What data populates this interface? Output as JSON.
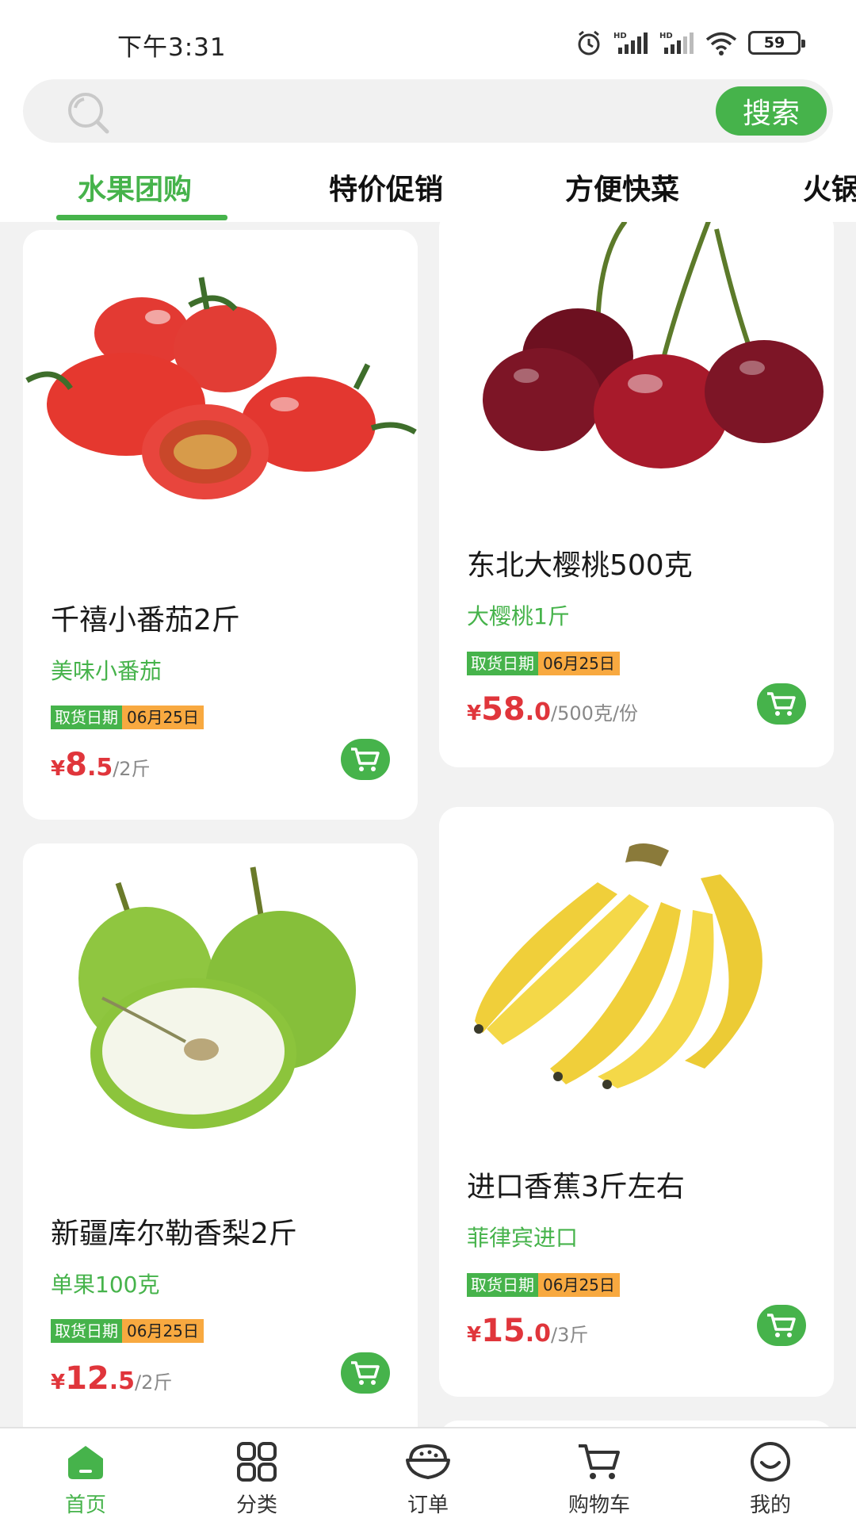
{
  "status_bar": {
    "time": "下午3:31",
    "battery": "59"
  },
  "search": {
    "placeholder": "",
    "button_label": "搜索"
  },
  "tabs": [
    {
      "label": "水果团购",
      "active": true
    },
    {
      "label": "特价促销",
      "active": false
    },
    {
      "label": "方便快菜",
      "active": false
    },
    {
      "label": "火锅",
      "active": false
    }
  ],
  "products": [
    {
      "name": "千禧小番茄2斤",
      "subtitle": "美味小番茄",
      "pickup_label": "取货日期",
      "pickup_date": "06月25日",
      "currency": "¥",
      "price_int": "8",
      "price_dec": ".5",
      "unit": "/2斤",
      "image": "cherry-tomatoes"
    },
    {
      "name": "东北大樱桃500克",
      "subtitle": "大樱桃1斤",
      "pickup_label": "取货日期",
      "pickup_date": "06月25日",
      "currency": "¥",
      "price_int": "58",
      "price_dec": ".0",
      "unit": "/500克/份",
      "image": "cherries"
    },
    {
      "name": "新疆库尔勒香梨2斤",
      "subtitle": "单果100克",
      "pickup_label": "取货日期",
      "pickup_date": "06月25日",
      "currency": "¥",
      "price_int": "12",
      "price_dec": ".5",
      "unit": "/2斤",
      "image": "pears"
    },
    {
      "name": "进口香蕉3斤左右",
      "subtitle": "菲律宾进口",
      "pickup_label": "取货日期",
      "pickup_date": "06月25日",
      "currency": "¥",
      "price_int": "15",
      "price_dec": ".0",
      "unit": "/3斤",
      "image": "bananas"
    }
  ],
  "bottom_nav": [
    {
      "label": "首页",
      "icon": "home-icon",
      "active": true
    },
    {
      "label": "分类",
      "icon": "grid-icon",
      "active": false
    },
    {
      "label": "订单",
      "icon": "bowl-icon",
      "active": false
    },
    {
      "label": "购物车",
      "icon": "cart-icon",
      "active": false
    },
    {
      "label": "我的",
      "icon": "smile-icon",
      "active": false
    }
  ],
  "colors": {
    "accent": "#46b34b",
    "price": "#e0353b",
    "date_badge": "#f8a940"
  }
}
